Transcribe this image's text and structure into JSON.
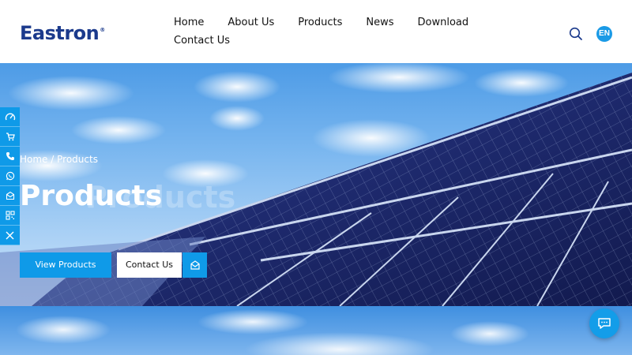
{
  "brand": {
    "name": "Eastron",
    "mark": "®"
  },
  "nav": {
    "items": [
      {
        "label": "Home"
      },
      {
        "label": "About Us"
      },
      {
        "label": "Products"
      },
      {
        "label": "News"
      },
      {
        "label": "Download"
      },
      {
        "label": "Contact Us"
      }
    ]
  },
  "header": {
    "lang_label": "EN",
    "search_icon": "search-icon"
  },
  "hero": {
    "breadcrumb_home": "Home",
    "breadcrumb_sep": "/",
    "breadcrumb_current": "Products",
    "title": "Products",
    "title_shadow": "Products",
    "view_button": "View Products",
    "contact_button": "Contact Us"
  },
  "sidebar": {
    "icons": [
      "speed-meter-icon",
      "cart-icon",
      "phone-icon",
      "whatsapp-icon",
      "email-icon",
      "qr-code-icon",
      "close-icon"
    ]
  },
  "colors": {
    "accent": "#0f9ae8",
    "brand": "#1b3a8c"
  }
}
